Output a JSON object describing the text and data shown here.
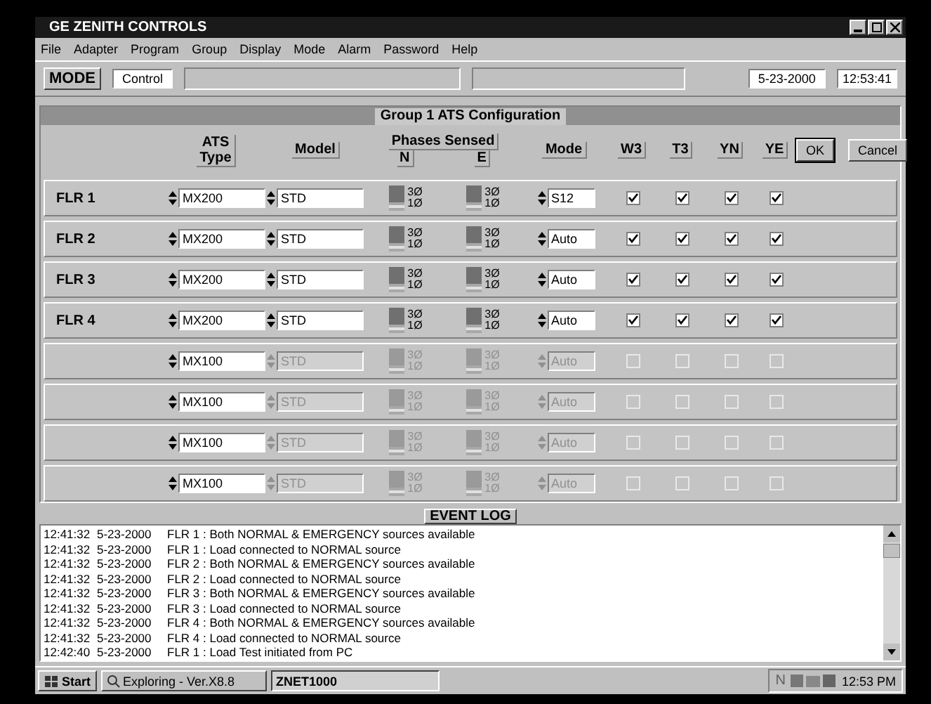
{
  "window": {
    "title": "GE ZENITH CONTROLS"
  },
  "menu": [
    "File",
    "Adapter",
    "Program",
    "Group",
    "Display",
    "Mode",
    "Alarm",
    "Password",
    "Help"
  ],
  "toolbar": {
    "label": "MODE",
    "mode": "Control",
    "date": "5-23-2000",
    "time": "12:53:41"
  },
  "panel": {
    "title": "Group 1  ATS Configuration",
    "columns": {
      "ats_type": [
        "ATS",
        "Type"
      ],
      "model": "Model",
      "phases": "Phases Sensed",
      "phase_n": "N",
      "phase_e": "E",
      "mode": "Mode",
      "flags": [
        "W3",
        "T3",
        "YN",
        "YE"
      ]
    },
    "buttons": [
      {
        "label": "OK",
        "default": true
      },
      {
        "label": "Cancel",
        "default": false
      }
    ],
    "rows": [
      {
        "label": "FLR 1",
        "enabled": true,
        "ats_type": "MX200",
        "model": "STD",
        "phase_n": [
          "3Ø",
          "1Ø"
        ],
        "phase_e": [
          "3Ø",
          "1Ø"
        ],
        "mode": "S12",
        "flags": [
          true,
          true,
          true,
          true
        ]
      },
      {
        "label": "FLR 2",
        "enabled": true,
        "ats_type": "MX200",
        "model": "STD",
        "phase_n": [
          "3Ø",
          "1Ø"
        ],
        "phase_e": [
          "3Ø",
          "1Ø"
        ],
        "mode": "Auto",
        "flags": [
          true,
          true,
          true,
          true
        ]
      },
      {
        "label": "FLR 3",
        "enabled": true,
        "ats_type": "MX200",
        "model": "STD",
        "phase_n": [
          "3Ø",
          "1Ø"
        ],
        "phase_e": [
          "3Ø",
          "1Ø"
        ],
        "mode": "Auto",
        "flags": [
          true,
          true,
          true,
          true
        ]
      },
      {
        "label": "FLR 4",
        "enabled": true,
        "ats_type": "MX200",
        "model": "STD",
        "phase_n": [
          "3Ø",
          "1Ø"
        ],
        "phase_e": [
          "3Ø",
          "1Ø"
        ],
        "mode": "Auto",
        "flags": [
          true,
          true,
          true,
          true
        ]
      },
      {
        "enabled": false,
        "ats_type": "MX100",
        "model": "STD",
        "phase_n": [
          "3Ø",
          "1Ø"
        ],
        "phase_e": [
          "3Ø",
          "1Ø"
        ],
        "mode": "Auto",
        "flags": [
          false,
          false,
          false,
          false
        ]
      },
      {
        "enabled": false,
        "ats_type": "MX100",
        "model": "STD",
        "phase_n": [
          "3Ø",
          "1Ø"
        ],
        "phase_e": [
          "3Ø",
          "1Ø"
        ],
        "mode": "Auto",
        "flags": [
          false,
          false,
          false,
          false
        ]
      },
      {
        "enabled": false,
        "ats_type": "MX100",
        "model": "STD",
        "phase_n": [
          "3Ø",
          "1Ø"
        ],
        "phase_e": [
          "3Ø",
          "1Ø"
        ],
        "mode": "Auto",
        "flags": [
          false,
          false,
          false,
          false
        ]
      },
      {
        "enabled": false,
        "ats_type": "MX100",
        "model": "STD",
        "phase_n": [
          "3Ø",
          "1Ø"
        ],
        "phase_e": [
          "3Ø",
          "1Ø"
        ],
        "mode": "Auto",
        "flags": [
          false,
          false,
          false,
          false
        ]
      }
    ]
  },
  "event_log": {
    "title": "EVENT LOG",
    "entries": [
      {
        "time": "12:41:32",
        "date": "5-23-2000",
        "message": "FLR 1 : Both NORMAL & EMERGENCY sources available"
      },
      {
        "time": "12:41:32",
        "date": "5-23-2000",
        "message": "FLR 1 : Load connected to NORMAL source"
      },
      {
        "time": "12:41:32",
        "date": "5-23-2000",
        "message": "FLR 2 : Both NORMAL & EMERGENCY sources available"
      },
      {
        "time": "12:41:32",
        "date": "5-23-2000",
        "message": "FLR 2 : Load connected to NORMAL source"
      },
      {
        "time": "12:41:32",
        "date": "5-23-2000",
        "message": "FLR 3 : Both NORMAL & EMERGENCY sources available"
      },
      {
        "time": "12:41:32",
        "date": "5-23-2000",
        "message": "FLR 3 : Load connected to NORMAL source"
      },
      {
        "time": "12:41:32",
        "date": "5-23-2000",
        "message": "FLR 4 : Both NORMAL & EMERGENCY sources available"
      },
      {
        "time": "12:41:32",
        "date": "5-23-2000",
        "message": "FLR 4 : Load connected to NORMAL source"
      },
      {
        "time": "12:42:40",
        "date": "5-23-2000",
        "message": "FLR 1 : Load Test initiated from PC"
      }
    ]
  },
  "taskbar": {
    "start": "Start",
    "tasks": [
      {
        "label": "Exploring - Ver.X8.8",
        "selected": false
      },
      {
        "label": "ZNET1000",
        "selected": true
      }
    ],
    "tray_text": "N",
    "clock": "12:53 PM"
  }
}
